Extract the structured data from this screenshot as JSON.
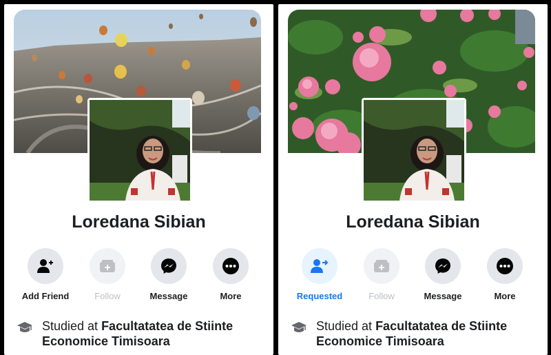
{
  "panels": [
    {
      "name": "Loredana Sibian",
      "actions": [
        {
          "label": "Add Friend",
          "icon": "add-friend-icon"
        },
        {
          "label": "Follow",
          "icon": "follow-icon"
        },
        {
          "label": "Message",
          "icon": "messenger-icon"
        },
        {
          "label": "More",
          "icon": "more-icon"
        }
      ],
      "study_prefix": "Studied at ",
      "study_school": "Facultatatea de Stiinte Economice Timisoara"
    },
    {
      "name": "Loredana Sibian",
      "actions": [
        {
          "label": "Requested",
          "icon": "friend-request-sent-icon"
        },
        {
          "label": "Follow",
          "icon": "follow-icon"
        },
        {
          "label": "Message",
          "icon": "messenger-icon"
        },
        {
          "label": "More",
          "icon": "more-icon"
        }
      ],
      "study_prefix": "Studied at ",
      "study_school": "Facultatatea de Stiinte Economice Timisoara"
    }
  ],
  "colors": {
    "accent": "#1877f2",
    "active_bg": "#e7f3ff",
    "button_bg": "#e4e6eb",
    "disabled": "#bcc0c4",
    "text": "#1c1e21"
  }
}
